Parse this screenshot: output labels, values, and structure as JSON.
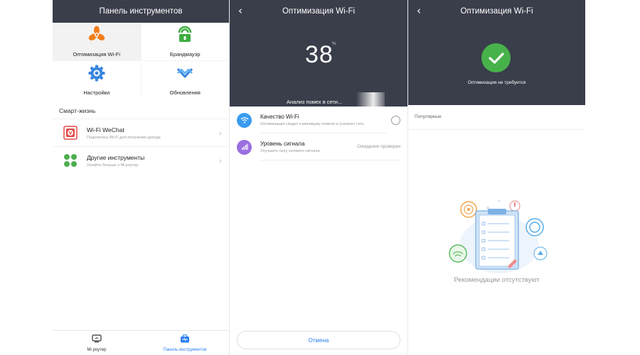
{
  "screen1": {
    "title": "Панель инструментов",
    "tiles": [
      {
        "label": "Оптимизация Wi-Fi",
        "icon": "fan-icon",
        "color": "#f07d1a"
      },
      {
        "label": "Брандмауэр",
        "icon": "firewall-icon",
        "color": "#3cae3f"
      },
      {
        "label": "Настройки",
        "icon": "gear-icon",
        "color": "#3a86e0"
      },
      {
        "label": "Обновления",
        "icon": "update-icon",
        "color": "#3a86e0"
      }
    ],
    "section_title": "Смарт-жизнь",
    "rows": [
      {
        "title": "Wi-Fi WeChat",
        "subtitle": "Поделитесь Wi-Fi для получения дохода",
        "icon": "wechat-icon"
      },
      {
        "title": "Другие инструменты",
        "subtitle": "Узнайте больше о Mi роутер",
        "icon": "apps-icon"
      }
    ],
    "tabs": [
      {
        "label": "Mi роутер",
        "icon": "router-icon"
      },
      {
        "label": "Панель инструментов",
        "icon": "toolbox-icon"
      }
    ]
  },
  "screen2": {
    "title": "Оптимизация Wi-Fi",
    "score": "38",
    "score_unit": "%",
    "analyzing_text": "Анализ помех в сети...",
    "checks": [
      {
        "title": "Качество Wi-Fi",
        "subtitle": "Оптимизация сводит к минимуму помехи и ускоряет сеть",
        "status": "",
        "icon": "wifi-icon",
        "color": "#3a9bf0"
      },
      {
        "title": "Уровень сигнала",
        "subtitle": "Улучшите силу сетевого сигнала",
        "status": "Ожидание проверки",
        "icon": "signal-icon",
        "color": "#9b6fe0"
      }
    ],
    "cancel_label": "Отмена"
  },
  "screen3": {
    "title": "Оптимизация Wi-Fi",
    "result_text": "Оптимизация не требуется",
    "popular_label": "Популярные",
    "empty_text": "Рекомендации отсутствуют"
  },
  "colors": {
    "header_bg": "#3a3d4a",
    "accent_blue": "#2b7ff0",
    "success_green": "#48b24a"
  }
}
